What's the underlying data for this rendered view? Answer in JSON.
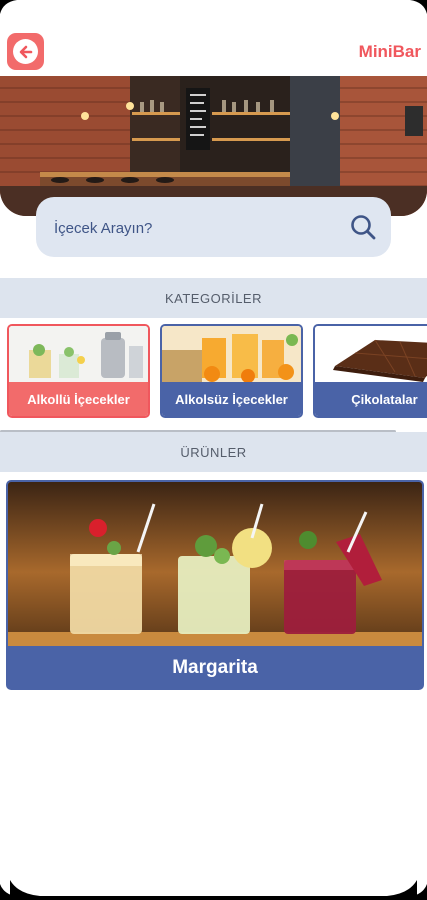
{
  "header": {
    "title": "MiniBar"
  },
  "search": {
    "placeholder": "İçecek Arayın?"
  },
  "categories_section": {
    "title": "KATEGORİLER"
  },
  "categories": [
    {
      "label": "Alkollü İçecekler",
      "selected": true
    },
    {
      "label": "Alkolsüz İçecekler",
      "selected": false
    },
    {
      "label": "Çikolatalar",
      "selected": false
    }
  ],
  "products_section": {
    "title": "ÜRÜNLER"
  },
  "products": [
    {
      "name": "Margarita"
    }
  ],
  "colors": {
    "accent_red": "#f0575d",
    "primary_blue": "#4a63a7",
    "section_bg": "#dde4ee",
    "search_bg": "#dfe6f1"
  },
  "icons": {
    "back": "arrow-left-circle-icon",
    "search": "magnifier-icon"
  }
}
